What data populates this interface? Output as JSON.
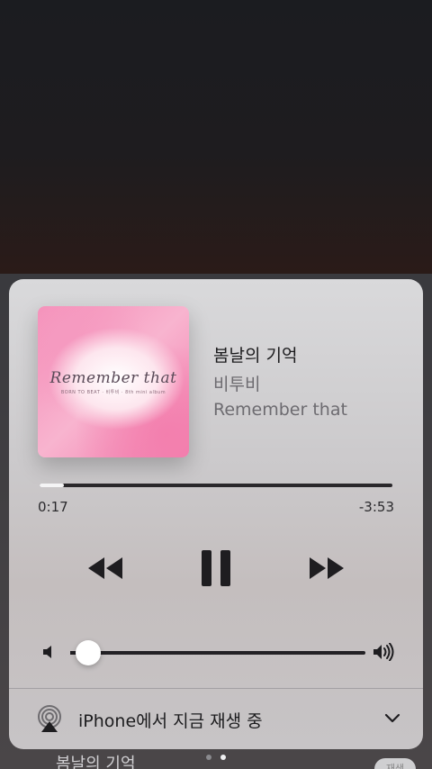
{
  "background": {
    "peek_title": "봄날의 기억",
    "peek_badge": "재생"
  },
  "now_playing": {
    "title": "봄날의 기억",
    "artist": "비투비",
    "album": "Remember that",
    "artwork": {
      "title": "Remember that",
      "subtitle": "BORN TO BEAT · 비투비 · 8th mini album",
      "colors": {
        "primary": "#f58cb7",
        "highlight": "#ffffff"
      }
    }
  },
  "playback": {
    "elapsed": "0:17",
    "remaining": "-3:53",
    "progress": 0.07,
    "state": "playing"
  },
  "controls": {
    "rewind_icon": "rewind-icon",
    "pause_icon": "pause-icon",
    "forward_icon": "fast-forward-icon"
  },
  "volume": {
    "level": 0.06,
    "low_icon": "volume-low-icon",
    "high_icon": "volume-high-icon"
  },
  "output": {
    "label": "iPhone에서 지금 재생 중",
    "icon": "airplay-icon",
    "expand_icon": "chevron-down-icon"
  },
  "page_indicator": {
    "count": 2,
    "active": 1
  }
}
